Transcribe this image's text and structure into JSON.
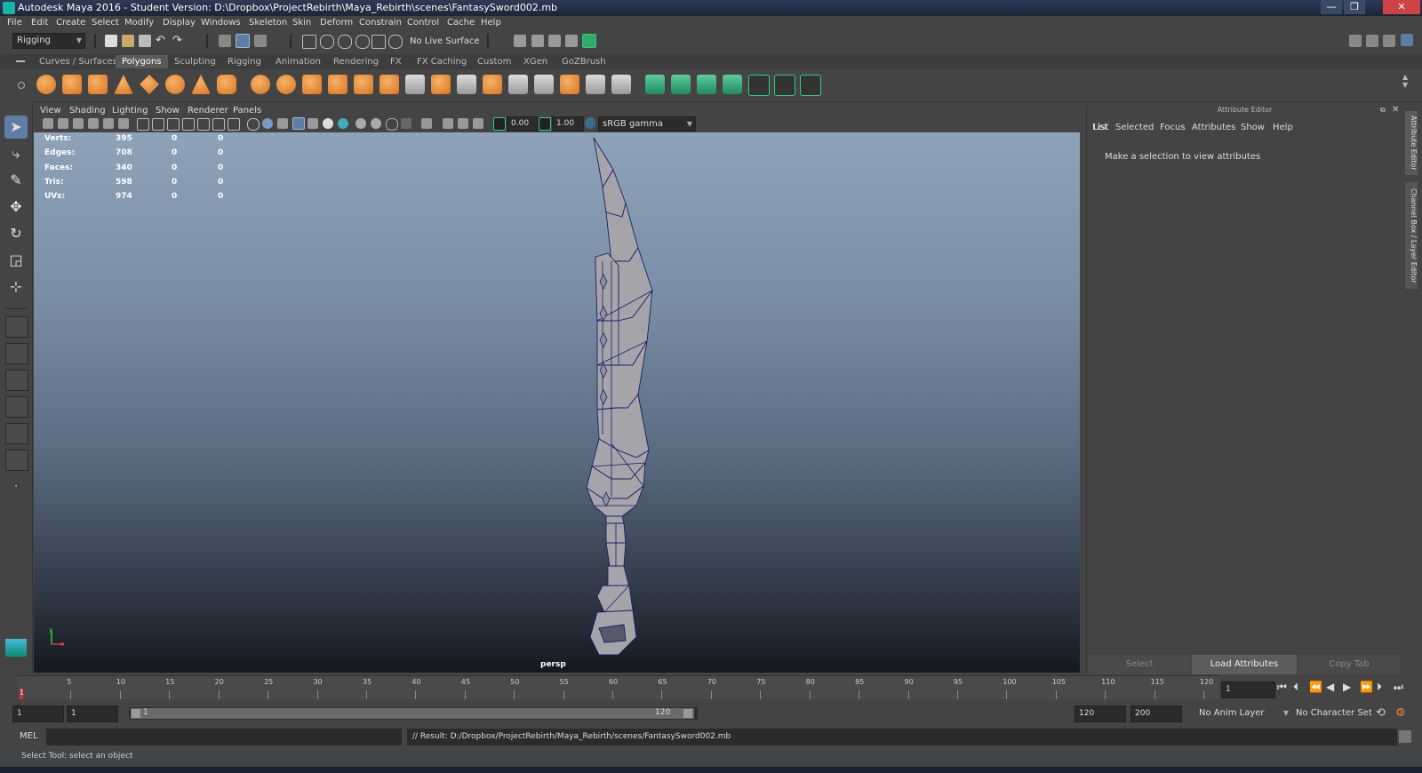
{
  "title": "Autodesk Maya 2016 - Student Version: D:\\Dropbox\\ProjectRebirth\\Maya_Rebirth\\scenes\\FantasySword002.mb",
  "window_controls": [
    "—",
    "❐",
    "✕"
  ],
  "menus": [
    "File",
    "Edit",
    "Create",
    "Select",
    "Modify",
    "Display",
    "Windows",
    "Skeleton",
    "Skin",
    "Deform",
    "Constrain",
    "Control",
    "Cache",
    "Help"
  ],
  "status_line": {
    "menu_set": "Rigging",
    "live_surface": "No Live Surface"
  },
  "shelf_tabs": [
    "Curves / Surfaces",
    "Polygons",
    "Sculpting",
    "Rigging",
    "Animation",
    "Rendering",
    "FX",
    "FX Caching",
    "Custom",
    "XGen",
    "GoZBrush"
  ],
  "active_shelf_tab": "Polygons",
  "panel_menu": [
    "View",
    "Shading",
    "Lighting",
    "Show",
    "Renderer",
    "Panels"
  ],
  "panel_toolbar": {
    "exposure": "0.00",
    "gamma": "1.00",
    "color_space": "sRGB gamma"
  },
  "hud": [
    {
      "label": "Verts:",
      "values": [
        "395",
        "0",
        "0"
      ]
    },
    {
      "label": "Edges:",
      "values": [
        "708",
        "0",
        "0"
      ]
    },
    {
      "label": "Faces:",
      "values": [
        "340",
        "0",
        "0"
      ]
    },
    {
      "label": "Tris:",
      "values": [
        "598",
        "0",
        "0"
      ]
    },
    {
      "label": "UVs:",
      "values": [
        "974",
        "0",
        "0"
      ]
    }
  ],
  "camera_label": "persp",
  "axis": {
    "x": "x",
    "y": "y"
  },
  "attribute_editor": {
    "title": "Attribute Editor",
    "menu": [
      "List",
      "Selected",
      "Focus",
      "Attributes",
      "Show",
      "Help"
    ],
    "message": "Make a selection to view attributes",
    "buttons": [
      "Select",
      "Load Attributes",
      "Copy Tab"
    ]
  },
  "side_tabs": [
    "Attribute Editor",
    "Channel Box / Layer Editor"
  ],
  "time_slider": {
    "ticks": [
      "5",
      "10",
      "15",
      "20",
      "25",
      "30",
      "35",
      "40",
      "45",
      "50",
      "55",
      "60",
      "65",
      "70",
      "75",
      "80",
      "85",
      "90",
      "95",
      "100",
      "105",
      "110",
      "115",
      "120"
    ],
    "current_marker": "1",
    "current_frame": "1"
  },
  "range_slider": {
    "start": "1",
    "playback_start": "1",
    "range_start_label": "1",
    "range_end_label": "120",
    "playback_end": "120",
    "end": "200",
    "anim_layer": "No Anim Layer",
    "character_set": "No Character Set"
  },
  "command_line": {
    "lang": "MEL",
    "result": "// Result: D:/Dropbox/ProjectRebirth/Maya_Rebirth/scenes/FantasySword002.mb"
  },
  "help_line": "Select Tool: select an object"
}
